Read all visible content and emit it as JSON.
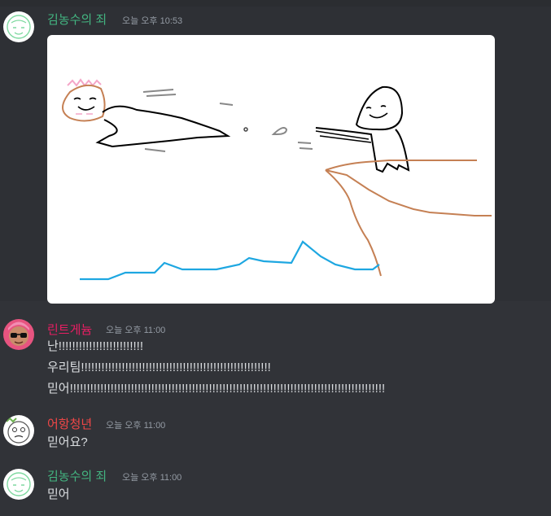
{
  "colors": {
    "background": "#313338",
    "name_green": "#43b581",
    "name_pink": "#e91e63",
    "name_red": "#f04747",
    "timestamp": "#949ba4",
    "text": "#dbdee1"
  },
  "messages": [
    {
      "author": "김농수의 죄",
      "timestamp": "오늘 오후 10:53",
      "attachment": {
        "type": "image",
        "description_icon": "drawing-image"
      }
    },
    {
      "author": "린트게늄",
      "timestamp": "오늘 오후 11:00",
      "lines": [
        "난!!!!!!!!!!!!!!!!!!!!!!!!!",
        "우리팀!!!!!!!!!!!!!!!!!!!!!!!!!!!!!!!!!!!!!!!!!!!!!!!!!!!!!!!!",
        "믿어!!!!!!!!!!!!!!!!!!!!!!!!!!!!!!!!!!!!!!!!!!!!!!!!!!!!!!!!!!!!!!!!!!!!!!!!!!!!!!!!!!!!!!!!!!!!!!!!!!!!!!!!!!!!!!!!!!!!!!!!!!!!!!!!!!!!!!!!!!!!\\"
      ]
    },
    {
      "author": "어항청년",
      "timestamp": "오늘 오후 11:00",
      "lines": [
        "믿어요?"
      ]
    },
    {
      "author": "김농수의 죄",
      "timestamp": "오늘 오후 11:00",
      "lines": [
        "믿어"
      ]
    }
  ]
}
